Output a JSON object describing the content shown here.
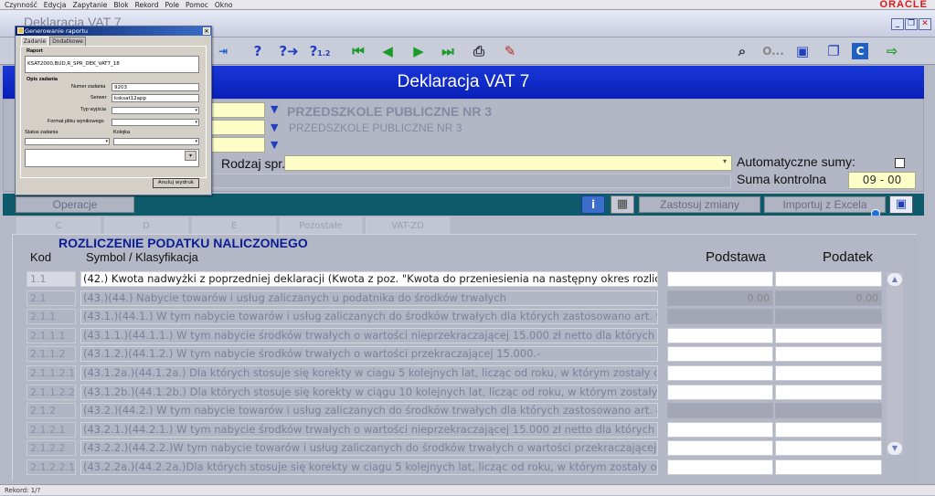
{
  "menubar": [
    "Czynność",
    "Edycja",
    "Zapytanie",
    "Blok",
    "Rekord",
    "Pole",
    "Pomoc",
    "Okno"
  ],
  "brand": "ORACLE",
  "window": {
    "title": "Deklaracja VAT 7"
  },
  "header": {
    "title": "Deklaracja VAT 7"
  },
  "filters": {
    "school_bold": "PRZEDSZKOLE PUBLICZNE NR 3",
    "school_plain": "PRZEDSZKOLE PUBLICZNE NR 3",
    "rodzaj_label": "Rodzaj spr.",
    "auto_sums_label": "Automatyczne sumy:",
    "checksum_label": "Suma kontrolna",
    "checksum_value": "09 - 00"
  },
  "ops": {
    "operacje": "Operacje",
    "info_icon": "i",
    "zastosuj": "Zastosuj zmiany",
    "import": "Importuj z Excela"
  },
  "tabs": [
    "C",
    "D",
    "E",
    "Pozostałe",
    "VAT-ZD"
  ],
  "grid": {
    "section_title": "ROZLICZENIE PODATKU NALICZONEGO",
    "col_kod": "Kod",
    "col_symbol": "Symbol / Klasyfikacja",
    "col_podstawa": "Podstawa",
    "col_podatek": "Podatek",
    "rows": [
      {
        "kod": "1.1",
        "text": "(42.) Kwota nadwyżki z poprzedniej deklaracji (Kwota z poz. \"Kwota do przeniesienia na następny okres rozliczeniowy\"",
        "podstawa": "",
        "podatek": "",
        "style": "first"
      },
      {
        "kod": "2.1",
        "text": "(43.)(44.) Nabycie towarów i usług zaliczanych u podatnika do środków trwałych",
        "podstawa": "0.00",
        "podatek": "0.00",
        "style": "gray"
      },
      {
        "kod": "2.1.1",
        "text": "(43.1.)(44.1.) W tym nabycie towarów i usług zaliczanych do  środków trwałych dla których zastosowano art. 90 ustawy",
        "podstawa": "",
        "podatek": "",
        "style": "gray"
      },
      {
        "kod": "2.1.1.1",
        "text": "(43.1.1.)(44.1.1.) W tym nabycie środków trwałych o wartości nieprzekraczającej 15.000 zł netto dla których zastosowa",
        "podstawa": "",
        "podatek": "",
        "style": "white"
      },
      {
        "kod": "2.1.1.2",
        "text": "(43.1.2.)(44.1.2.) W tym nabycie środków trwałych o wartości przekraczającej 15.000.-",
        "podstawa": "",
        "podatek": "",
        "style": "white"
      },
      {
        "kod": "2.1.1.2.1",
        "text": "(43.1.2a.)(44.1.2a.) Dla których stosuje się korekty w ciagu 5 kolejnych lat, licząc od roku, w którym zostały oddane do",
        "podstawa": "",
        "podatek": "",
        "style": "white"
      },
      {
        "kod": "2.1.1.2.2",
        "text": "(43.1.2b.)(44.1.2b.) Dla których stosuje się korekty w ciągu 10 kolejnych lat, licząc od roku, w którym zostały oddane do",
        "podstawa": "",
        "podatek": "",
        "style": "white"
      },
      {
        "kod": "2.1.2",
        "text": "(43.2.)(44.2.) W tym nabycie towarów i usług zaliczanych do  środków trwałych dla których zastosowano art. 86 ust. 2a",
        "podstawa": "",
        "podatek": "",
        "style": "gray"
      },
      {
        "kod": "2.1.2.1",
        "text": "(43.2.1.)(44.2.1.) W tym nabycie środków trwałych o wartości nieprzekraczającej 15.000 zł netto dla których zastosowa",
        "podstawa": "",
        "podatek": "",
        "style": "white"
      },
      {
        "kod": "2.1.2.2",
        "text": "(43.2.2.)(44.2.2.)W tym nabycie towarów i usług zaliczanych do  środków trwałych o wartości przekraczającej 15.000,-",
        "podstawa": "",
        "podatek": "",
        "style": "white"
      },
      {
        "kod": "2.1.2.2.1",
        "text": "(43.2.2a.)(44.2.2a.)Dla których stosuje się korekty w ciagu 5 kolejnych lat, licząc od roku, w którym zostały oddane do",
        "podstawa": "",
        "podatek": "",
        "style": "white"
      }
    ]
  },
  "dialog": {
    "title": "Generowanie raportu",
    "tabs": [
      "Zadanie",
      "Dodatkowe"
    ],
    "report_label": "Raport",
    "report_value": "KSAT2000,BUD,R_SPR_DEK_VAT7_18",
    "job_desc_label": "Opis zadania",
    "job_number_label": "Numer zadania",
    "job_number_value": "9203",
    "server_label": "Serwer",
    "server_value": "ksksat12app",
    "output_type_label": "Typ wyjścia",
    "format_label": "Format pliku wynikowego",
    "status_label": "Status zadania",
    "queue_label": "Kolejka",
    "cancel_button": "Anuluj wydruk"
  },
  "statusbar": {
    "record": "Rekord: 1/?"
  },
  "colors": {
    "header_blue": "#1030c8",
    "ops_band": "#0d5a6a",
    "field_yellow": "#fdfdc8",
    "title_navy": "#0a1d96"
  },
  "icons": [
    "help-icon",
    "help-next-icon",
    "help-count-icon",
    "first-record-icon",
    "prev-record-icon",
    "next-record-icon",
    "last-record-icon",
    "print-icon",
    "edit-icon",
    "find-icon",
    "other-icon",
    "save-icon",
    "window-icon",
    "c-icon",
    "exit-icon"
  ]
}
